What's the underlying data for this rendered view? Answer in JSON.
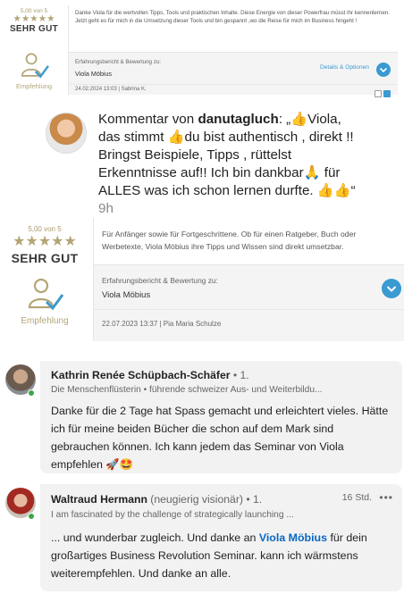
{
  "review1": {
    "score": "5,00 von 5",
    "stars": "★★★★★",
    "grade": "SEHR GUT",
    "recommendation": "Empfehlung",
    "text": "Danke Viola für die wertvollen Tipps, Tools und praktischen Inhalte. Diese Energie von dieser Powerfrau müsst ihr kennenlernen. Jetzt geht es für mich in die Umsetzung dieser Tools und bin gespannt ,wo die Reise für mich im Business hingeht !",
    "report_label": "Erfahrungsbericht & Bewertung zu:",
    "reviewed_name": "Viola Möbius",
    "details_label": "Details & Optionen",
    "date": "24.02.2024 13:03 | Sabrina K."
  },
  "comment": {
    "prefix": "Kommentar von ",
    "author": "danutagluch",
    "text": ": „👍Viola, das stimmt 👍du bist authentisch , direkt !! Bringst Beispiele, Tipps , rüttelst Erkenntnisse auf!! Ich bin dankbar🙏 für ALLES was ich schon lernen durfte. 👍👍“",
    "ago": " 9h"
  },
  "review2": {
    "score": "5,00 von 5",
    "stars": "★★★★★",
    "grade": "SEHR GUT",
    "recommendation": "Empfehlung",
    "text": "Für Anfänger sowie für Fortgeschrittene. Ob für einen Ratgeber, Buch oder Werbetexte, Viola Möbius ihre Tipps und Wissen sind direkt umsetzbar.",
    "report_label": "Erfahrungsbericht & Bewertung zu:",
    "reviewed_name": "Viola Möbius",
    "date": "22.07.2023 13:37 | Pia Maria Schulze"
  },
  "linkedin1": {
    "name": "Kathrin Renée Schüpbach-Schäfer",
    "degree": " • 1.",
    "headline": "Die Menschenflüsterin • führende schweizer Aus- und Weiterbildu...",
    "message": "Danke für die 2 Tage hat Spass gemacht und erleichtert vieles. Hätte ich für meine beiden Bücher die schon auf dem Mark sind gebrauchen können. Ich kann jedem das Seminar von Viola empfehlen 🚀🤩"
  },
  "linkedin2": {
    "name": "Waltraud Hermann",
    "tagline": "  (neugierig visionär)",
    "degree": " • 1.",
    "time": "16 Std.",
    "more": "•••",
    "headline": "I am fascinated by the challenge of strategically launching ...",
    "message_before": "... und wunderbar zugleich. Und danke an ",
    "mention": "Viola Möbius",
    "message_after": " für dein großartiges Business Revolution Seminar. kann ich wärmstens weiterempfehlen. Und danke an alle."
  },
  "colors": {
    "gold": "#b4a577",
    "accent_blue": "#3a9ad1",
    "linkedin_blue": "#0a66c2",
    "online_green": "#3aa84a"
  }
}
